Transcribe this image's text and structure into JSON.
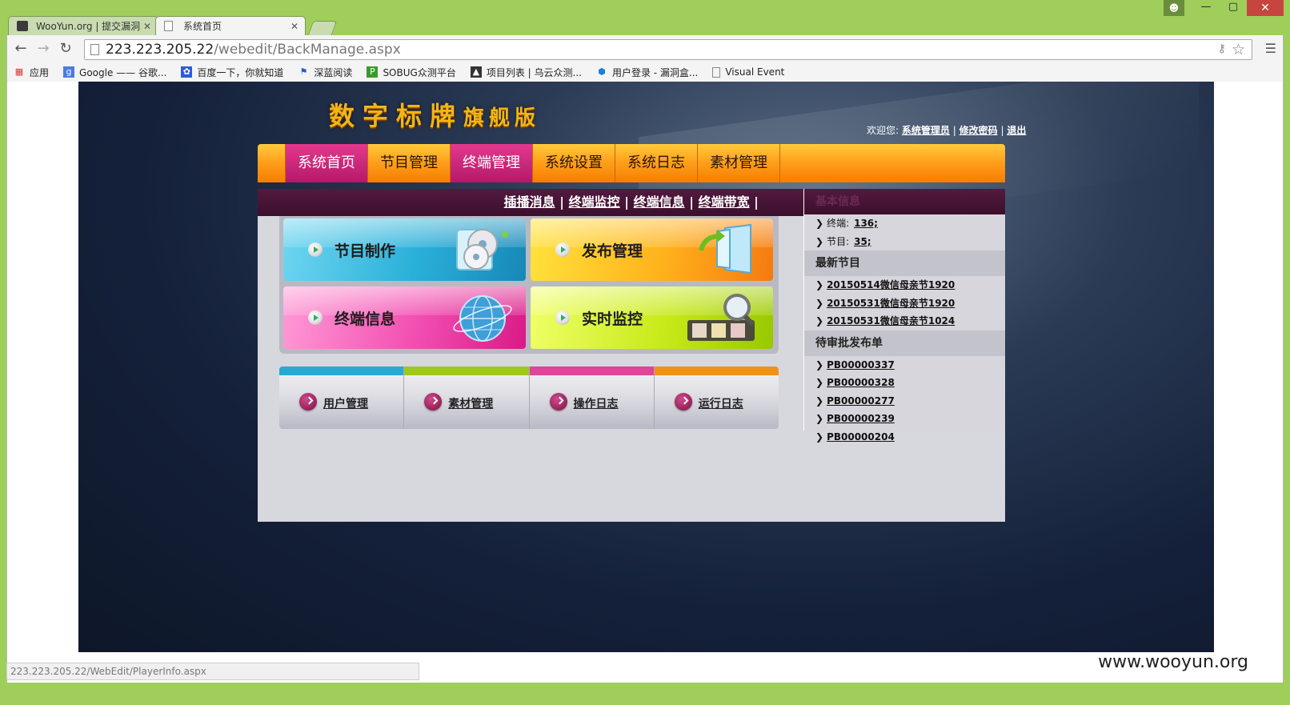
{
  "browser": {
    "tabs": [
      {
        "title": "WooYun.org | 提交漏洞",
        "active": false
      },
      {
        "title": "系统首页",
        "active": true
      }
    ],
    "url_host": "223.223.205.22",
    "url_path": "/webedit/BackManage.aspx",
    "bookmarks": [
      "应用",
      "Google —— 谷歌...",
      "百度一下，你就知道",
      "深蓝阅读",
      "SOBUG众测平台",
      "项目列表 | 乌云众测...",
      "用户登录 - 漏洞盒...",
      "Visual Event"
    ],
    "status_url": "223.223.205.22/WebEdit/PlayerInfo.aspx"
  },
  "header": {
    "logo_main": "数字标牌",
    "logo_sub": "旗舰版",
    "welcome_prefix": "欢迎您:",
    "user": "系统管理员",
    "change_password": "修改密码",
    "logout": "退出",
    "sep": "|"
  },
  "nav": [
    "系统首页",
    "节目管理",
    "终端管理",
    "系统设置",
    "系统日志",
    "素材管理"
  ],
  "subnav": [
    "插播消息",
    "终端监控",
    "终端信息",
    "终端带宽"
  ],
  "tiles": [
    "节目制作",
    "发布管理",
    "终端信息",
    "实时监控"
  ],
  "quick_links": [
    "用户管理",
    "素材管理",
    "操作日志",
    "运行日志"
  ],
  "sidebar": {
    "basic_title": "基本信息",
    "basic": [
      {
        "label": "终端:",
        "value": "136;"
      },
      {
        "label": "节目:",
        "value": "35;"
      }
    ],
    "latest_title": "最新节目",
    "latest": [
      "20150514微信母亲节1920",
      "20150531微信母亲节1920",
      "20150531微信母亲节1024"
    ],
    "pending_title": "待审批发布单",
    "pending": [
      "PB00000337",
      "PB00000328",
      "PB00000277",
      "PB00000239",
      "PB00000204"
    ]
  },
  "watermark": "www.wooyun.org",
  "colors": {
    "nav_orange": "#ffa11e",
    "nav_active": "#c8207a",
    "subbar": "#4a1638",
    "tile_blue": "#2ab0d8",
    "tile_orange": "#ffb21c",
    "tile_pink": "#f24fb1",
    "tile_green": "#c8ea1a"
  }
}
